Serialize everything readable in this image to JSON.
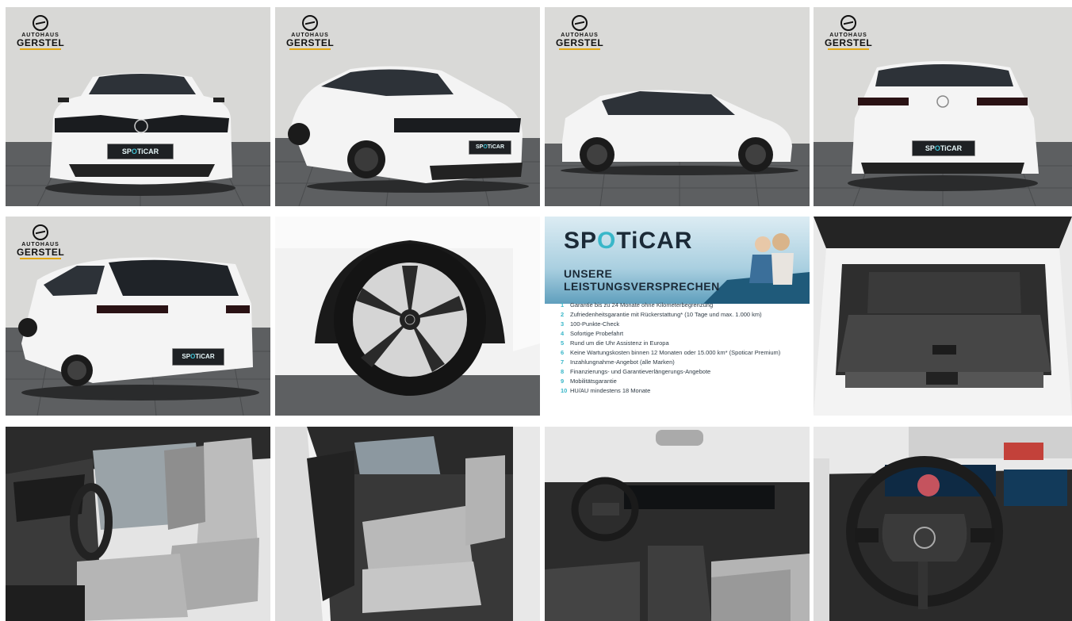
{
  "logo": {
    "line1": "AUTOHAUS",
    "line2": "GERSTEL"
  },
  "plate": {
    "prefix": "SP",
    "accent": "O",
    "suffix": "TiCAR"
  },
  "promo": {
    "brand_prefix": "SP",
    "brand_accent": "O",
    "brand_suffix": "TiCAR",
    "heading_line1": "UNSERE",
    "heading_line2": "LEISTUNGSVERSPRECHEN",
    "items": [
      {
        "num": "1",
        "text": "Garantie bis zu 24 Monate ohne Kilometerbegrenzung"
      },
      {
        "num": "2",
        "text": "Zufriedenheitsgarantie mit Rückerstattung* (10 Tage und max. 1.000 km)"
      },
      {
        "num": "3",
        "text": "100-Punkte-Check"
      },
      {
        "num": "4",
        "text": "Sofortige Probefahrt"
      },
      {
        "num": "5",
        "text": "Rund um die Uhr Assistenz in Europa"
      },
      {
        "num": "6",
        "text": "Keine Wartungskosten binnen 12 Monaten oder 15.000 km* (Spoticar Premium)"
      },
      {
        "num": "7",
        "text": "Inzahlungnahme-Angebot (alle Marken)"
      },
      {
        "num": "8",
        "text": "Finanzierungs- und Garantieverlängerungs-Angebote"
      },
      {
        "num": "9",
        "text": "Mobilitätsgarantie"
      },
      {
        "num": "10",
        "text": "HU/AU mindestens 18 Monate"
      }
    ]
  },
  "colors": {
    "accent": "#39b7c9",
    "brand_dark": "#1b2a37",
    "logo_gold": "#e0a612"
  }
}
